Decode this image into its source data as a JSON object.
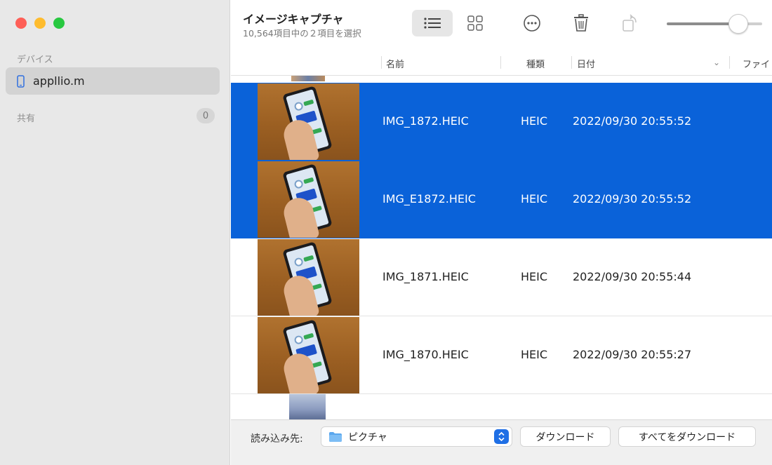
{
  "app": {
    "title": "イメージキャプチャ",
    "selection_status": "10,564項目中の２項目を選択"
  },
  "sidebar": {
    "devices_header": "デバイス",
    "device_name": "appllio.m",
    "shared_header": "共有",
    "shared_count": "0"
  },
  "table": {
    "columns": {
      "name": "名前",
      "kind": "種類",
      "date": "日付",
      "file": "ファイ"
    },
    "rows": [
      {
        "name": "IMG_1872.HEIC",
        "kind": "HEIC",
        "date": "2022/09/30 20:55:52",
        "selected": true
      },
      {
        "name": "IMG_E1872.HEIC",
        "kind": "HEIC",
        "date": "2022/09/30 20:55:52",
        "selected": true
      },
      {
        "name": "IMG_1871.HEIC",
        "kind": "HEIC",
        "date": "2022/09/30 20:55:44",
        "selected": false
      },
      {
        "name": "IMG_1870.HEIC",
        "kind": "HEIC",
        "date": "2022/09/30 20:55:27",
        "selected": false
      }
    ]
  },
  "footer": {
    "import_to_label": "読み込み先:",
    "import_to_value": "ピクチャ",
    "download_label": "ダウンロード",
    "download_all_label": "すべてをダウンロード"
  },
  "toolbar": {
    "thumbnail_size": 0.75
  },
  "colors": {
    "selection": "#0a62d9",
    "sidebar_bg": "#e8e8e8",
    "accent": "#1f6fe5"
  }
}
